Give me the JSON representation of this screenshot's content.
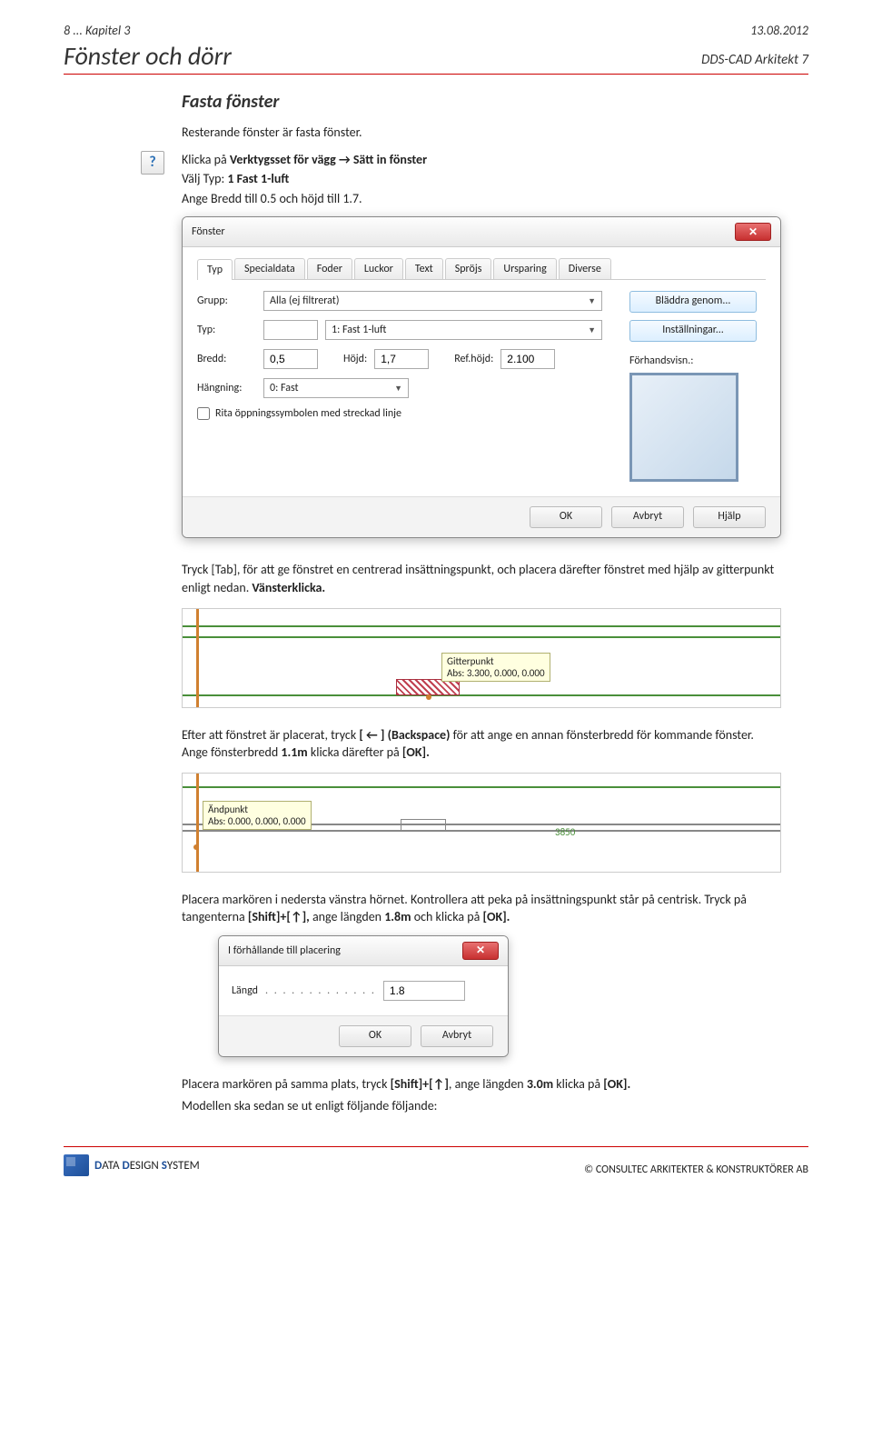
{
  "header": {
    "chapter": "8 ... Kapitel 3",
    "date": "13.08.2012",
    "title": "Fönster och dörr",
    "subtitle": "DDS-CAD Arkitekt 7"
  },
  "section": {
    "title": "Fasta fönster",
    "intro": "Resterande fönster är fasta fönster.",
    "p1_prefix": "Klicka på ",
    "p1_bold": "Verktygsset för vägg → Sätt in fönster",
    "p2_prefix": "Välj Typ: ",
    "p2_bold": "1 Fast 1-luft",
    "p3": "Ange Bredd till 0.5 och höjd till 1.7.",
    "after_dialog": "Tryck [Tab], för att ge fönstret en centrerad insättningspunkt, och placera därefter fönstret med hjälp av gitterpunkt enligt nedan. ",
    "after_dialog_bold": "Vänsterklicka.",
    "after_plan1_a": "Efter att fönstret är placerat, tryck ",
    "after_plan1_b": "[ ← ] (Backspace)",
    "after_plan1_c": " för att ange en annan fönsterbredd för kommande fönster. Ange fönsterbredd ",
    "after_plan1_d": "1.1m",
    "after_plan1_e": " klicka därefter på ",
    "after_plan1_f": "[OK].",
    "after_plan2_a": "Placera markören i nedersta vänstra hörnet. Kontrollera att peka på insättningspunkt står på centrisk. Tryck på tangenterna ",
    "after_plan2_b": "[Shift]+[↑],",
    "after_plan2_c": " ange längden ",
    "after_plan2_d": "1.8m",
    "after_plan2_e": " och klicka på ",
    "after_plan2_f": "[OK].",
    "closing_a": "Placera markören på samma plats, tryck ",
    "closing_b": "[Shift]+[↑]",
    "closing_c": ", ange längden ",
    "closing_d": "3.0m",
    "closing_e": " klicka på ",
    "closing_f": "[OK].",
    "closing2": "Modellen ska sedan se ut enligt följande följande:"
  },
  "dialog": {
    "title": "Fönster",
    "tabs": [
      "Typ",
      "Specialdata",
      "Foder",
      "Luckor",
      "Text",
      "Spröjs",
      "Ursparing",
      "Diverse"
    ],
    "grupp_label": "Grupp:",
    "grupp_value": "Alla (ej filtrerat)",
    "typ_label": "Typ:",
    "typ_code": "",
    "typ_value": "1: Fast 1-luft",
    "browse": "Bläddra genom...",
    "bredd_label": "Bredd:",
    "bredd_value": "0,5",
    "hojd_label": "Höjd:",
    "hojd_value": "1,7",
    "refhojd_label": "Ref.höjd:",
    "refhojd_value": "2.100",
    "settings": "Inställningar...",
    "hangning_label": "Hängning:",
    "hangning_value": "0: Fast",
    "preview_label": "Förhandsvisn.:",
    "checkbox": "Rita öppningssymbolen med streckad linje",
    "ok": "OK",
    "cancel": "Avbryt",
    "help": "Hjälp"
  },
  "plan1": {
    "tooltip_title": "Gitterpunkt",
    "tooltip_value": "Abs: 3.300, 0.000, 0.000"
  },
  "plan2": {
    "tooltip_title": "Ändpunkt",
    "tooltip_value": "Abs: 0.000, 0.000, 0.000",
    "dim": "3850"
  },
  "small_dialog": {
    "title": "I förhållande till placering",
    "label": "Längd",
    "value": "1.8",
    "ok": "OK",
    "cancel": "Avbryt"
  },
  "footer": {
    "brand1": "D",
    "brand2": "ATA ",
    "brand3": "D",
    "brand4": "ESIGN ",
    "brand5": "S",
    "brand6": "YSTEM",
    "copyright": "©  CONSULTEC ARKITEKTER & KONSTRUKTÖRER AB"
  }
}
